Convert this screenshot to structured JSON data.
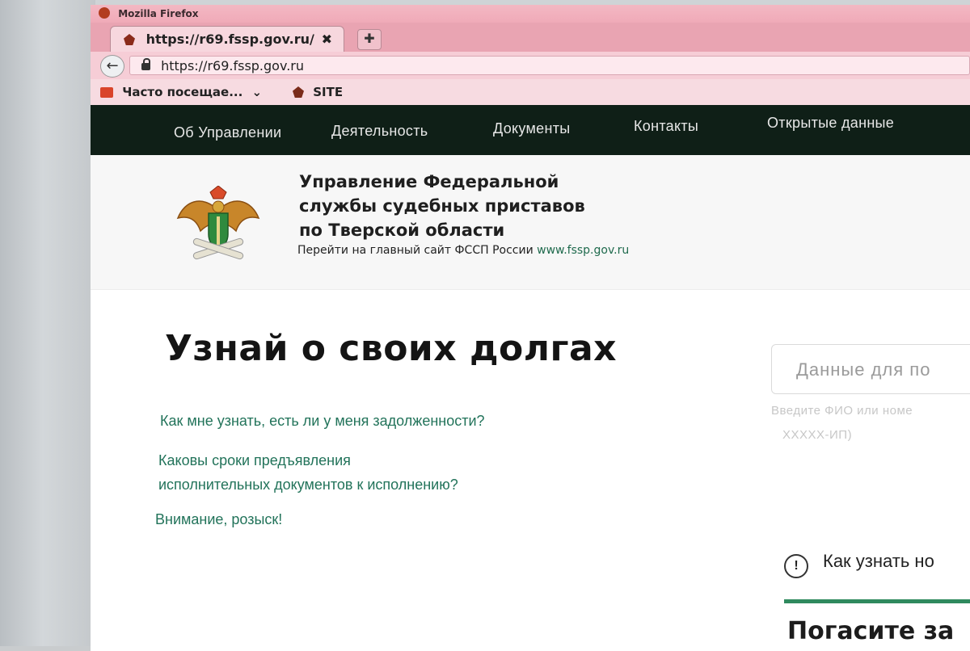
{
  "browser": {
    "window_title": "Mozilla Firefox",
    "tab_title": "https://r69.fssp.gov.ru/",
    "tab_close": "✖",
    "new_tab": "✚",
    "back": "←",
    "url": "https://r69.fssp.gov.ru",
    "bookmarks": [
      {
        "label": "Часто посещае...",
        "icon": "folder-icon",
        "suffix": "⌄"
      },
      {
        "label": "SITE",
        "icon": "site-favicon-icon"
      }
    ]
  },
  "site_nav": [
    "Об Управлении",
    "Деятельность",
    "Документы",
    "Контакты",
    "Открытые данные"
  ],
  "header": {
    "org_line1": "Управление Федеральной",
    "org_line2": "службы судебных приставов",
    "org_line3": "по Тверской области",
    "link_prefix": "Перейти на главный сайт ФССП России",
    "link_text": "www.fssp.gov.ru"
  },
  "main": {
    "title": "Узнай о своих долгах",
    "faq": [
      "Как мне узнать, есть ли у меня задолженности?",
      "Каковы сроки предъявления",
      "исполнительных документов к исполнению?",
      "Внимание, розыск!"
    ],
    "search_placeholder": "Данные для по",
    "hint_line1": "Введите ФИО или номе",
    "hint_line2": "ХХХХХ-ИП)",
    "howto": "Как узнать но",
    "pay": "Погасите за"
  },
  "colors": {
    "nav_bg": "#0f1f17",
    "link_green": "#22735a",
    "accent_green": "#2f8a5e",
    "firefox_tint": "#f0aab8"
  }
}
